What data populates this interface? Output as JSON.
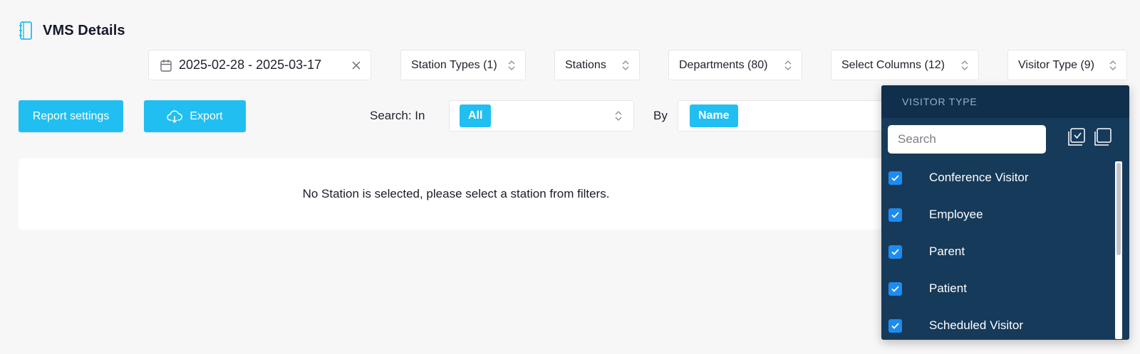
{
  "header": {
    "title": "VMS Details",
    "icon": "notebook-icon"
  },
  "filters": {
    "date_range": "2025-02-28 - 2025-03-17",
    "station_types": "Station Types (1)",
    "stations": "Stations",
    "departments": "Departments (80)",
    "select_columns": "Select Columns (12)",
    "visitor_type": "Visitor Type (9)"
  },
  "actions": {
    "report_settings": "Report settings",
    "export": "Export",
    "search_in_label": "Search: In",
    "search_in_value": "All",
    "by_label": "By",
    "by_value": "Name"
  },
  "main": {
    "empty_message": "No Station is selected, please select a station from filters."
  },
  "dropdown": {
    "header": "VISITOR TYPE",
    "search_placeholder": "Search",
    "items": [
      {
        "label": "Conference Visitor",
        "checked": true
      },
      {
        "label": "Employee",
        "checked": true
      },
      {
        "label": "Parent",
        "checked": true
      },
      {
        "label": "Patient",
        "checked": true
      },
      {
        "label": "Scheduled Visitor",
        "checked": true
      }
    ]
  },
  "colors": {
    "accent": "#21bff1",
    "dropdown_bg": "#163a5a",
    "dropdown_header_bg": "#0f2f4c",
    "checkbox": "#1d8cf0",
    "page_bg": "#f8f7f8"
  }
}
